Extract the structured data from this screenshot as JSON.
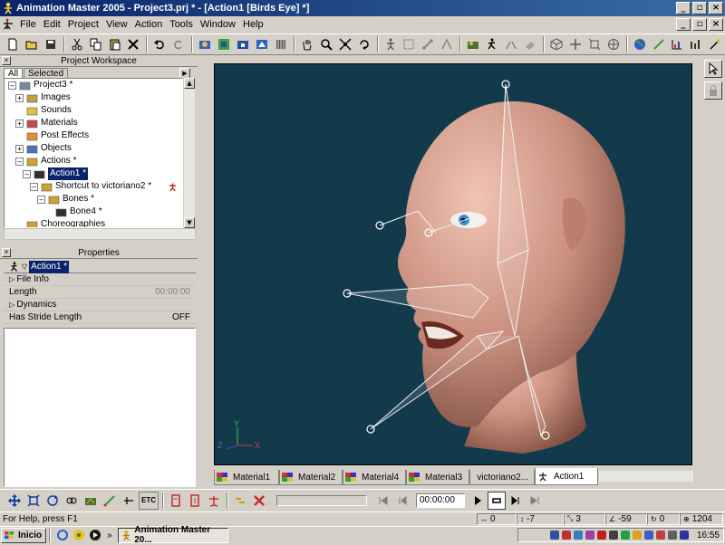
{
  "window": {
    "title": "Animation Master 2005 - Project3.prj * - [Action1 [Birds Eye] *]"
  },
  "menu": [
    "File",
    "Edit",
    "Project",
    "View",
    "Action",
    "Tools",
    "Window",
    "Help"
  ],
  "workspace": {
    "title": "Project Workspace",
    "tabs": [
      "All",
      "Selected"
    ],
    "tree": [
      {
        "label": "Project3 *",
        "indent": 0,
        "expander": "–"
      },
      {
        "label": "Images",
        "indent": 1,
        "expander": "+"
      },
      {
        "label": "Sounds",
        "indent": 1,
        "expander": ""
      },
      {
        "label": "Materials",
        "indent": 1,
        "expander": "+"
      },
      {
        "label": "Post Effects",
        "indent": 1,
        "expander": ""
      },
      {
        "label": "Objects",
        "indent": 1,
        "expander": "+"
      },
      {
        "label": "Actions *",
        "indent": 1,
        "expander": "–"
      },
      {
        "label": "Action1 *",
        "indent": 2,
        "expander": "–"
      },
      {
        "label": "Shortcut to victoriano2 *",
        "indent": 3,
        "expander": "–"
      },
      {
        "label": "Bones *",
        "indent": 4,
        "expander": "–"
      },
      {
        "label": "Bone4 *",
        "indent": 5,
        "expander": ""
      },
      {
        "label": "Choreographies",
        "indent": 1,
        "expander": ""
      }
    ]
  },
  "properties": {
    "title": "Properties",
    "selected": "Action1 *",
    "rows": [
      {
        "label": "File Info",
        "value": ""
      },
      {
        "label": "Length",
        "value": "00:00:00"
      },
      {
        "label": "Dynamics",
        "value": ""
      },
      {
        "label": "Has Stride Length",
        "value": "OFF"
      }
    ]
  },
  "viewport": {
    "bg_color": "#123a4b",
    "skin_color": "#c98f7e",
    "axis": {
      "y": "Y",
      "z": "Z",
      "x": "X"
    }
  },
  "view_tabs": [
    "Material1",
    "Material2",
    "Material4",
    "Material3",
    "victoriano2...",
    "Action1"
  ],
  "timeline": {
    "time": "00:00:00",
    "etc": "ETC"
  },
  "status": {
    "help": "For Help, press F1",
    "fields": [
      "0",
      "-7",
      "3",
      "-59",
      "0",
      "1204"
    ]
  },
  "taskbar": {
    "start": "Inicio",
    "task": "Animation Master 20...",
    "clock": "16:55",
    "more": "»"
  },
  "colors": {
    "titlebar": "#0a246a",
    "selection": "#0a246a",
    "face": "#d4d0c8"
  }
}
